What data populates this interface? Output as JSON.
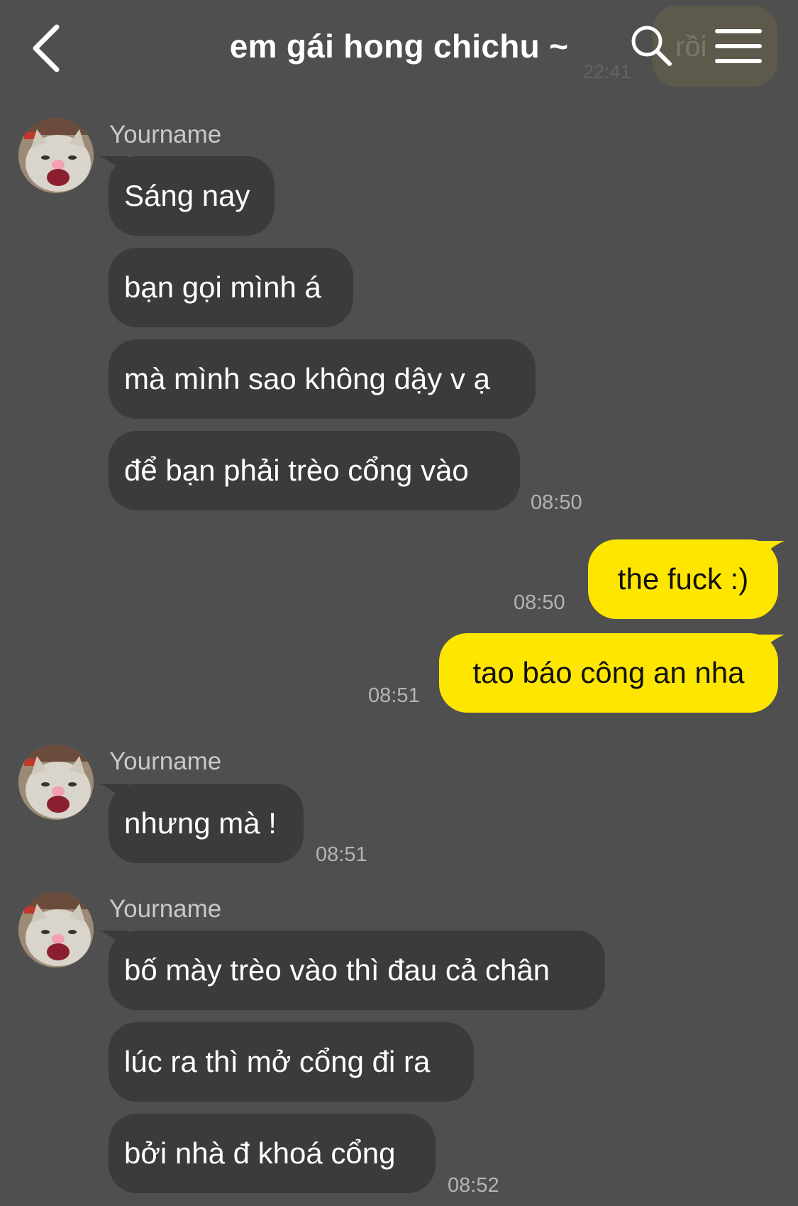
{
  "header": {
    "title": "em gái hong chichu ~",
    "ghost_text": "rồi",
    "ghost_time": "22:41",
    "icons": [
      "chevron-left-icon",
      "search-icon",
      "hamburger-menu-icon"
    ]
  },
  "colors": {
    "background": "#4f4f4f",
    "incoming_bubble": "#3b3b3d",
    "outgoing_bubble": "#ffe600",
    "timestamp": "#b4b4b4"
  },
  "messages": {
    "g1": {
      "sender": "Yourname",
      "m1": "Sáng nay",
      "m2": "bạn gọi mình á",
      "m3": "mà mình sao không dậy v ạ",
      "m4": "để bạn phải trèo cổng vào",
      "time": "08:50"
    },
    "o1": {
      "text": "the fuck :)",
      "time": "08:50"
    },
    "o2": {
      "text": "tao báo công an nha",
      "time": "08:51"
    },
    "g2": {
      "sender": "Yourname",
      "m1": "nhưng mà !",
      "time": "08:51"
    },
    "g3": {
      "sender": "Yourname",
      "m1": "bố mày trèo vào thì đau cả chân",
      "m2": "lúc ra thì mở cổng đi ra",
      "m3": "bởi nhà đ khoá cổng",
      "time": "08:52"
    }
  }
}
